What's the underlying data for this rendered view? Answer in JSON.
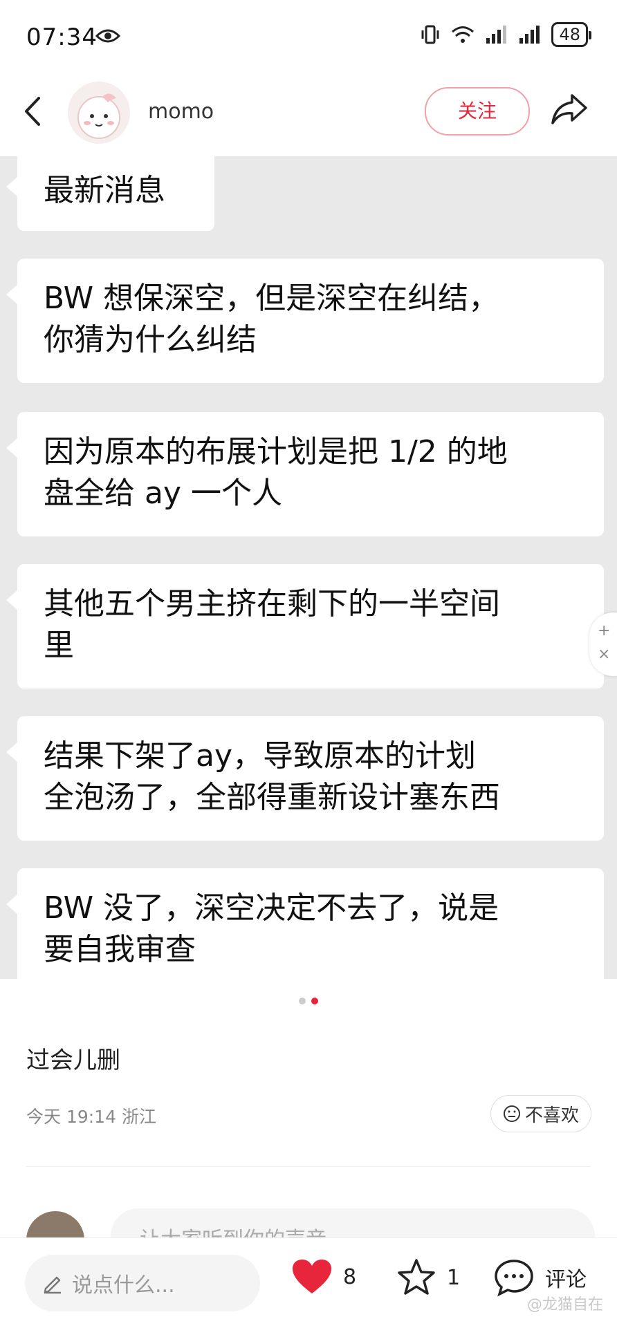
{
  "status_bar": {
    "time": "07:34",
    "battery": "48"
  },
  "header": {
    "username": "momo",
    "follow_label": "关注"
  },
  "messages": [
    {
      "lines": [
        "最新消息"
      ]
    },
    {
      "lines": [
        "BW 想保深空，但是深空在纠结，",
        "你猜为什么纠结"
      ]
    },
    {
      "lines": [
        "因为原本的布展计划是把 1/2 的地",
        "盘全给 ay 一个人"
      ]
    },
    {
      "lines": [
        "其他五个男主挤在剩下的一半空间",
        "里"
      ]
    },
    {
      "lines": [
        "结果下架了ay，导致原本的计划",
        "全泡汤了，全部得重新设计塞东西"
      ]
    },
    {
      "lines": [
        "BW 没了，深空决定不去了，说是",
        "要自我审查"
      ]
    }
  ],
  "post": {
    "caption": "过会儿删",
    "meta": "今天 19:14 浙江",
    "dislike_label": "不喜欢"
  },
  "comment": {
    "placeholder": "让大家听到你的声音"
  },
  "bottom_bar": {
    "say_placeholder": "说点什么...",
    "like_count": "8",
    "star_count": "1",
    "comment_label": "评论"
  },
  "watermark": "@龙猫自在",
  "colors": {
    "accent": "#e8263b",
    "image_bg": "#e9e9e9"
  }
}
